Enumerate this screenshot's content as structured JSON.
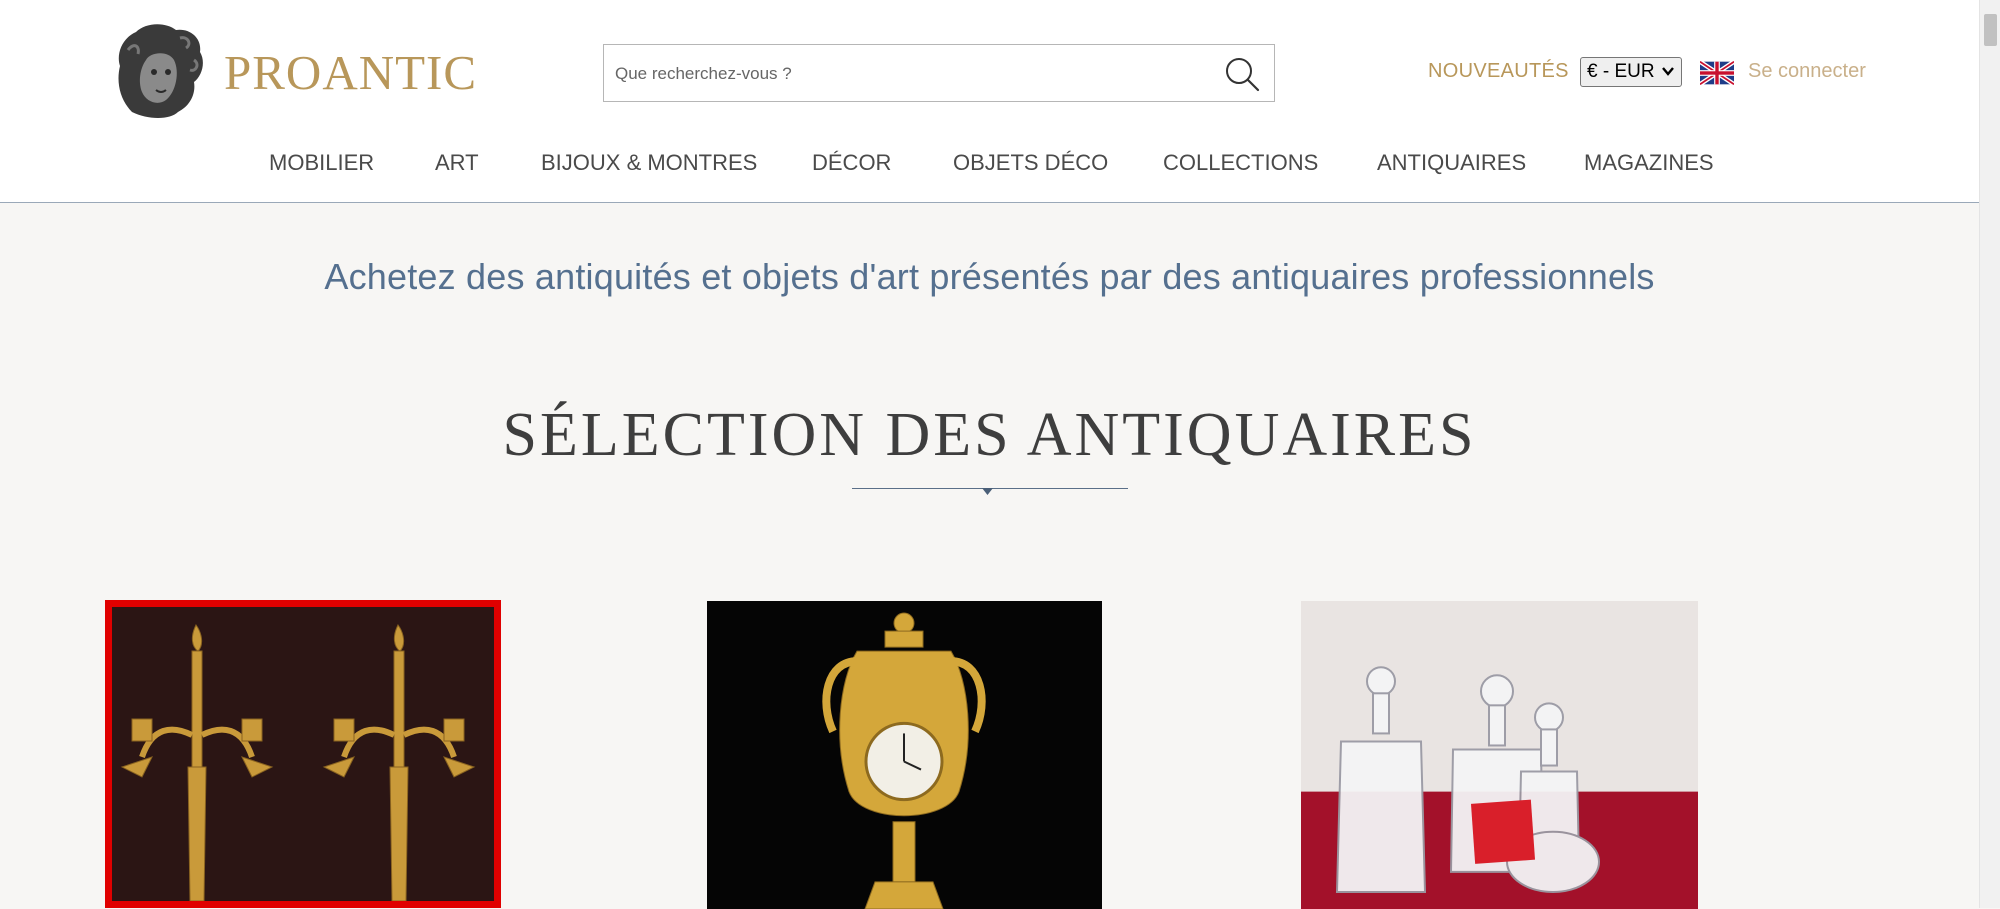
{
  "header": {
    "logo_text": "PROANTIC",
    "search_placeholder": "Que recherchez-vous ?",
    "nouveautes": "NOUVEAUTÉS",
    "currency": "€ - EUR",
    "connect": "Se connecter"
  },
  "nav": {
    "items": [
      "MOBILIER",
      "ART",
      "BIJOUX & MONTRES",
      "DÉCOR",
      "OBJETS DÉCO",
      "COLLECTIONS",
      "ANTIQUAIRES",
      "MAGAZINES"
    ]
  },
  "main": {
    "tagline": "Achetez des antiquités et objets d'art présentés par des antiquaires professionnels",
    "section_title": "SÉLECTION DES ANTIQUAIRES"
  },
  "cards": [
    {
      "subject": "candelabra-pair",
      "selected": true
    },
    {
      "subject": "gilt-vase-clock",
      "selected": false
    },
    {
      "subject": "crystal-carafes",
      "selected": false
    }
  ],
  "colors": {
    "accent_gold": "#b8975a",
    "tagline_blue": "#55708f",
    "selection_red": "#e00000",
    "page_bg": "#f7f6f4"
  },
  "icons": [
    "logo-bust-icon",
    "search-icon",
    "uk-flag-icon",
    "chevron-down-icon",
    "divider-diamond-icon"
  ]
}
